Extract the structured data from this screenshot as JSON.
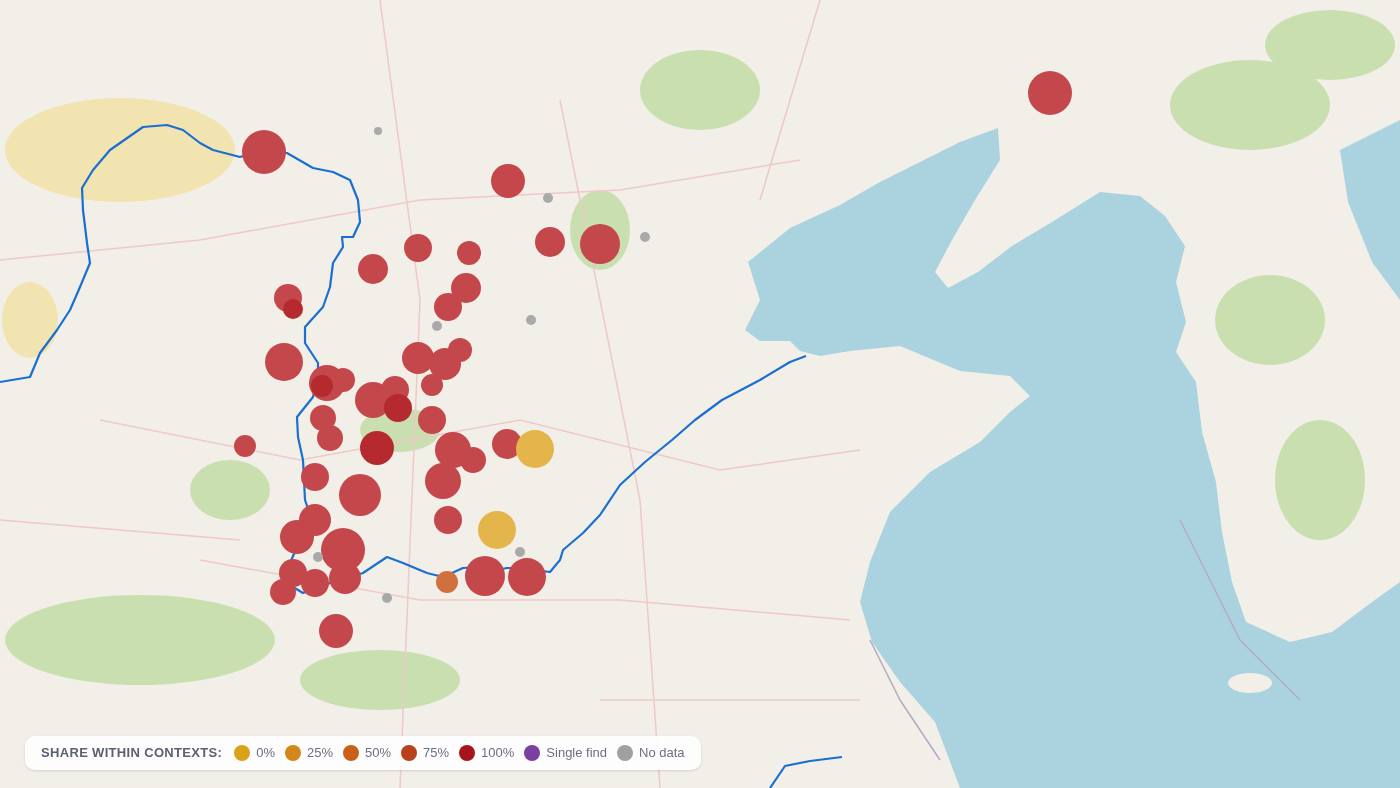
{
  "map": {
    "markers": [
      {
        "color": "#c4484b"
      },
      {
        "color": "#c4484b"
      },
      {
        "color": "#c4484b"
      },
      {
        "color": "#c4484b"
      },
      {
        "color": "#c4484b"
      },
      {
        "color": "#c4484b"
      },
      {
        "color": "#c4484b"
      },
      {
        "color": "#c4484b"
      },
      {
        "color": "#c4484b"
      },
      {
        "color": "#b52a2e"
      },
      {
        "color": "#c4484b"
      },
      {
        "color": "#c4484b"
      },
      {
        "color": "#c4484b"
      },
      {
        "color": "#c4484b"
      },
      {
        "color": "#c4484b"
      },
      {
        "color": "#c4484b"
      },
      {
        "color": "#c4484b"
      },
      {
        "color": "#c4484b"
      },
      {
        "color": "#b52a2e"
      },
      {
        "color": "#c4484b"
      },
      {
        "color": "#c4484b"
      },
      {
        "color": "#b52a2e"
      },
      {
        "color": "#c4484b"
      },
      {
        "color": "#c4484b"
      },
      {
        "color": "#c4484b"
      },
      {
        "color": "#b52a2e"
      },
      {
        "color": "#c4484b"
      },
      {
        "color": "#c4484b"
      },
      {
        "color": "#c4484b"
      },
      {
        "color": "#c4484b"
      },
      {
        "color": "#c4484b"
      },
      {
        "color": "#e4b54a"
      },
      {
        "color": "#c4484b"
      },
      {
        "color": "#c4484b"
      },
      {
        "color": "#c4484b"
      },
      {
        "color": "#c4484b"
      },
      {
        "color": "#c4484b"
      },
      {
        "color": "#e4b54a"
      },
      {
        "color": "#c4484b"
      },
      {
        "color": "#c4484b"
      },
      {
        "color": "#c4484b"
      },
      {
        "color": "#c4484b"
      },
      {
        "color": "#c4484b"
      },
      {
        "color": "#d0703f"
      },
      {
        "color": "#c4484b"
      },
      {
        "color": "#c4484b"
      },
      {
        "color": "#c4484b"
      },
      {
        "color": "#c4484b"
      },
      {
        "color": "#a9a9a9"
      },
      {
        "color": "#a9a9a9"
      },
      {
        "color": "#a9a9a9"
      },
      {
        "color": "#a9a9a9"
      },
      {
        "color": "#a9a9a9"
      },
      {
        "color": "#a9a9a9"
      },
      {
        "color": "#a9a9a9"
      },
      {
        "color": "#a9a9a9"
      }
    ]
  },
  "legend": {
    "title": "SHARE WITHIN CONTEXTS:",
    "items": [
      {
        "label": "0%",
        "color": "#d9a21b"
      },
      {
        "label": "25%",
        "color": "#d4861a"
      },
      {
        "label": "50%",
        "color": "#c8601a"
      },
      {
        "label": "75%",
        "color": "#b8401a"
      },
      {
        "label": "100%",
        "color": "#a8141c"
      },
      {
        "label": "Single find",
        "color": "#7b3fa0"
      },
      {
        "label": "No data",
        "color": "#a0a0a0"
      }
    ]
  }
}
